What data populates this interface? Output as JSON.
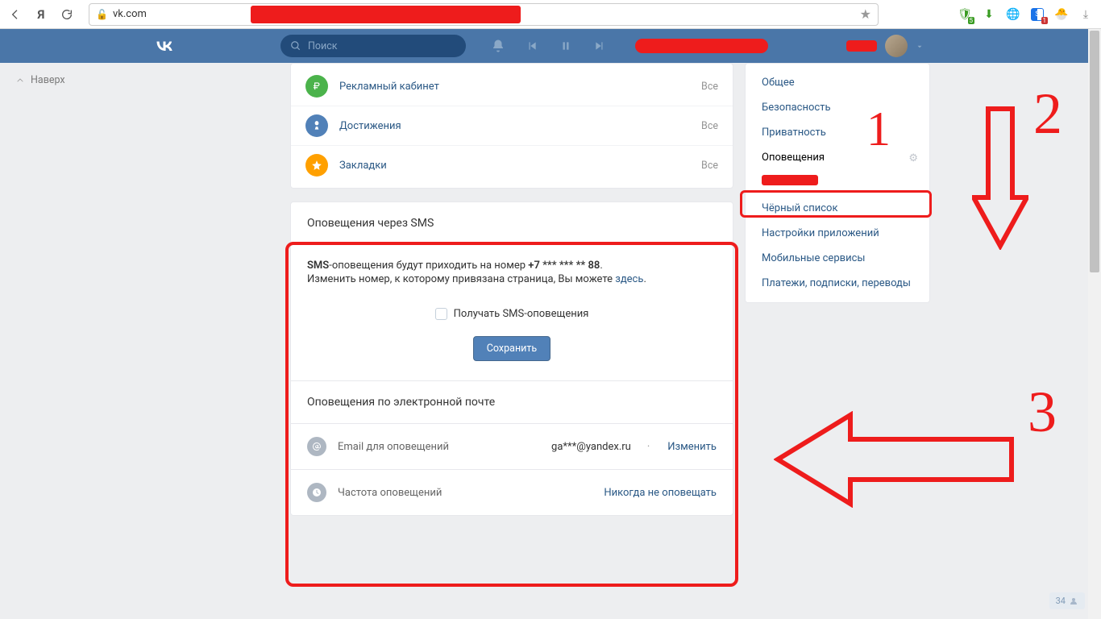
{
  "browser": {
    "url": "vk.com",
    "ext_badge_shield": "5",
    "ext_badge_s": "1"
  },
  "vk_header": {
    "search_placeholder": "Поиск"
  },
  "back_top": "Наверх",
  "menu": {
    "items": [
      {
        "label": "Рекламный кабинет",
        "all": "Все"
      },
      {
        "label": "Достижения",
        "all": "Все"
      },
      {
        "label": "Закладки",
        "all": "Все"
      }
    ]
  },
  "sms": {
    "title": "Оповещения через SMS",
    "prefix_bold": "SMS",
    "line1_after": "-оповещения будут приходить на номер ",
    "phone_bold": "+7 *** *** ** 88",
    "line2_before": "Изменить номер, к которому привязана страница, Вы можете ",
    "line2_link": "здесь",
    "checkbox_label": "Получать SMS-оповещения",
    "save": "Сохранить"
  },
  "email": {
    "title": "Оповещения по электронной почте",
    "rows": [
      {
        "label": "Email для оповещений",
        "value": "ga***@yandex.ru",
        "action": "Изменить"
      },
      {
        "label": "Частота оповещений",
        "action": "Никогда не оповещать"
      }
    ]
  },
  "settings_nav": {
    "items": [
      {
        "label": "Общее"
      },
      {
        "label": "Безопасность"
      },
      {
        "label": "Приватность"
      },
      {
        "label": "Оповещения",
        "active": true
      }
    ],
    "items2": [
      {
        "label": "Чёрный список"
      },
      {
        "label": "Настройки приложений"
      },
      {
        "label": "Мобильные сервисы"
      },
      {
        "label": "Платежи, подписки, переводы"
      }
    ]
  },
  "corner_count": "34",
  "annotations": {
    "n1": "1",
    "n2": "2",
    "n3": "3"
  }
}
